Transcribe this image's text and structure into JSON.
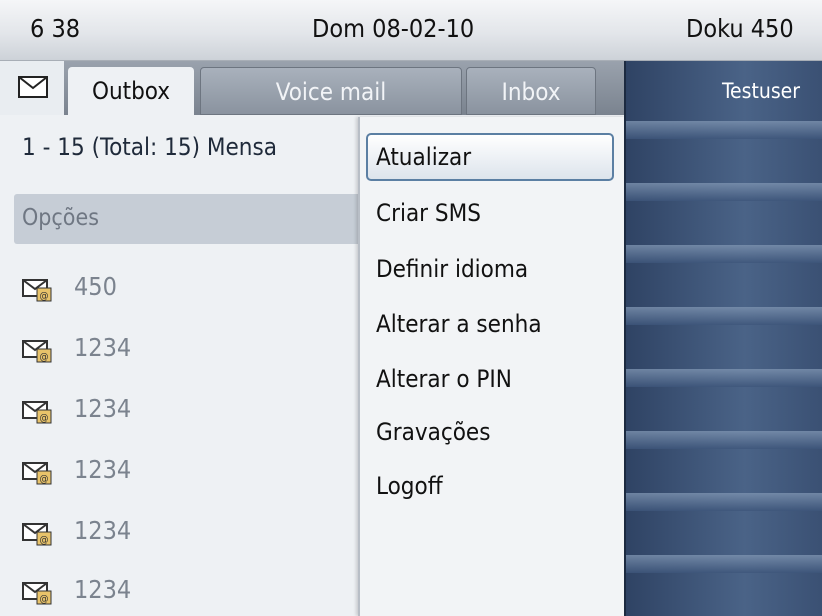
{
  "status": {
    "time": "6 38",
    "date": "Dom 08-02-10",
    "user": "Doku 450"
  },
  "tabs": {
    "outbox": "Outbox",
    "voicemail": "Voice mail",
    "inbox": "Inbox"
  },
  "messages": {
    "count_label": "1 - 15 (Total: 15) Mensa",
    "options_label": "Opções",
    "rows": [
      "450",
      "1234",
      "1234",
      "1234",
      "1234",
      "1234"
    ]
  },
  "menu": {
    "items": [
      "Atualizar",
      "Criar SMS",
      "Definir idioma",
      "Alterar a senha",
      "Alterar o PIN",
      "Gravações",
      "Logoff"
    ]
  },
  "right_panel": {
    "title": "Testuser"
  },
  "icons": {
    "mail": "envelope-icon",
    "message": "mail-message-icon"
  }
}
